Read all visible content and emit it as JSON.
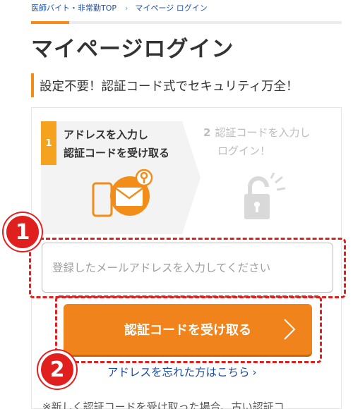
{
  "breadcrumb": {
    "home": "医師バイト・非常勤TOP",
    "separator": "›",
    "current": "マイページ ログイン"
  },
  "page": {
    "title": "マイページログイン",
    "subtitle": "設定不要！認証コード式でセキュリティ万全！"
  },
  "steps": [
    {
      "number": "1",
      "line1": "アドレスを入力し",
      "line2": "認証コードを受け取る",
      "icon": "mail-phone-icon",
      "active": true
    },
    {
      "number": "2",
      "line1": "認証コードを入力し",
      "line2": "ログイン！",
      "icon": "unlock-icon",
      "active": false
    }
  ],
  "form": {
    "email_placeholder": "登録したメールアドレスを入力してください",
    "submit_label": "認証コードを受け取る",
    "forgot_link": "アドレスを忘れた方はこちら",
    "forgot_chevron": "›"
  },
  "annotations": {
    "badge1": "1",
    "badge2": "2"
  },
  "note": "※新しく認証コードを受け取った場合、古い認証コ",
  "colors": {
    "accent": "#f28d1a",
    "button": "#f0831c",
    "annotation": "#e01f1f",
    "link": "#1f4fa6"
  }
}
